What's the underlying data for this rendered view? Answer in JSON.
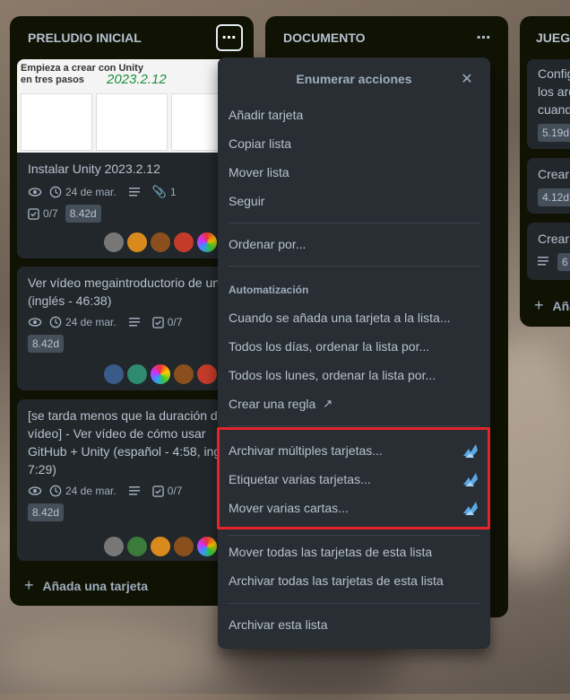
{
  "lists": [
    {
      "title": "PRELUDIO INICIAL",
      "cards": [
        {
          "cover": {
            "heading_line1": "Empieza a crear con Unity",
            "heading_line2": "en tres pasos",
            "handwritten": "2023.2.12"
          },
          "title": "Instalar Unity 2023.2.12",
          "date": "24 de mar.",
          "attachments": "1",
          "checklist": "0/7",
          "estimate": "8.42d"
        },
        {
          "title_line1": "Ver vídeo megaintroductorio de un",
          "title_line2": "(inglés - 46:38)",
          "date": "24 de mar.",
          "checklist": "0/7",
          "estimate": "8.42d"
        },
        {
          "title_line1": "[se tarda menos que la duración d",
          "title_line2": "vídeo] - Ver vídeo de cómo usar",
          "title_line3": "GitHub + Unity (español - 4:58, ing",
          "title_line4": "7:29)",
          "date": "24 de mar.",
          "checklist": "0/7",
          "estimate": "8.42d"
        }
      ],
      "add_card": "Añada una tarjeta"
    },
    {
      "title": "DOCUMENTO"
    },
    {
      "title": "JUEGO",
      "cards": [
        {
          "line1": "Config",
          "line2": "los arc",
          "line3": "cuand",
          "chip": "5.19d"
        },
        {
          "line1": "Crear",
          "chip": "4.12d"
        },
        {
          "line1": "Crear",
          "chip": "6"
        }
      ],
      "add_card": "Aña"
    }
  ],
  "menu": {
    "title": "Enumerar acciones",
    "items_top": [
      "Añadir tarjeta",
      "Copiar lista",
      "Mover lista",
      "Seguir"
    ],
    "sort": "Ordenar por...",
    "automation_header": "Automatización",
    "automation_items": [
      "Cuando se añada una tarjeta a la lista...",
      "Todos los días, ordenar la lista por...",
      "Todos los lunes, ordenar la lista por...",
      "Crear una regla"
    ],
    "bulk_items": [
      "Archivar múltiples tarjetas...",
      "Etiquetar varias tarjetas...",
      "Mover varias cartas..."
    ],
    "move_archive_items": [
      "Mover todas las tarjetas de esta lista",
      "Archivar todas las tarjetas de esta lista"
    ],
    "archive_list": "Archivar esta lista"
  },
  "colors": {
    "list_bg": "#101204",
    "card_bg": "#22272b",
    "popover_bg": "#282e33",
    "highlight": "#e5242a",
    "bird": "#5aa9e6"
  }
}
